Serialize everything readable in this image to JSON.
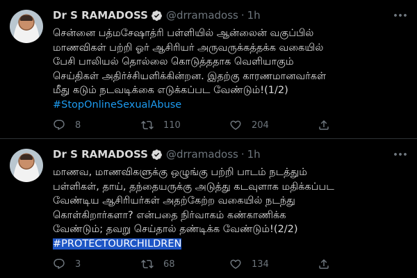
{
  "tweets": [
    {
      "author": {
        "name": "Dr S RAMADOSS",
        "handle": "@drramadoss",
        "time": "1h"
      },
      "lines": [
        "சென்னை பத்மசேஷாத்ரி பள்ளியில் ஆன்லைன் வகுப்பில்",
        "மாணவிகள் பற்றி ஓர் ஆசிரியர் அருவருக்கத்தக்க வகையில்",
        "பேசி பாலியல் தொல்லை கொடுத்ததாக வெளியாகும்",
        "செய்திகள் அதிர்ச்சியளிக்கின்றன. இதற்கு காரணமானவர்கள்",
        "மீது கடும் நடவடிக்கை எடுக்கப்பட வேண்டும்!(1/2)"
      ],
      "hashtag": "#StopOnlineSexualAbuse",
      "stats": {
        "replies": "8",
        "retweets": "110",
        "likes": "204"
      }
    },
    {
      "author": {
        "name": "Dr S RAMADOSS",
        "handle": "@drramadoss",
        "time": "1h"
      },
      "lines": [
        "மாணவ, மாணவிகளுக்கு ஒழுங்கு பற்றி பாடம் நடத்தும்",
        "பள்ளிகள், தாய், தந்தையருக்கு அடுத்து கடவுளாக மதிக்கப்பட",
        "வேண்டிய ஆசிரியர்கள்  அதற்கேற்ற வகையில் நடந்து",
        "கொள்கிறார்களா? என்பதை நிர்வாகம் கண்காணிக்க",
        "வேண்டும்; தவறு செய்தால் தண்டிக்க வேண்டும்!(2/2)"
      ],
      "hashtag": "#PROTECTOURCHILDREN",
      "stats": {
        "replies": "3",
        "retweets": "68",
        "likes": "134"
      }
    }
  ],
  "colors": {
    "background": "#000000",
    "text": "#d9d9d9",
    "muted": "#6e767d",
    "link": "#1d9bf0",
    "selection": "#1e56c6",
    "verified": "#d9d9d9"
  },
  "icons": [
    "verified-badge-icon",
    "more-icon",
    "reply-icon",
    "retweet-icon",
    "like-icon",
    "share-icon"
  ]
}
